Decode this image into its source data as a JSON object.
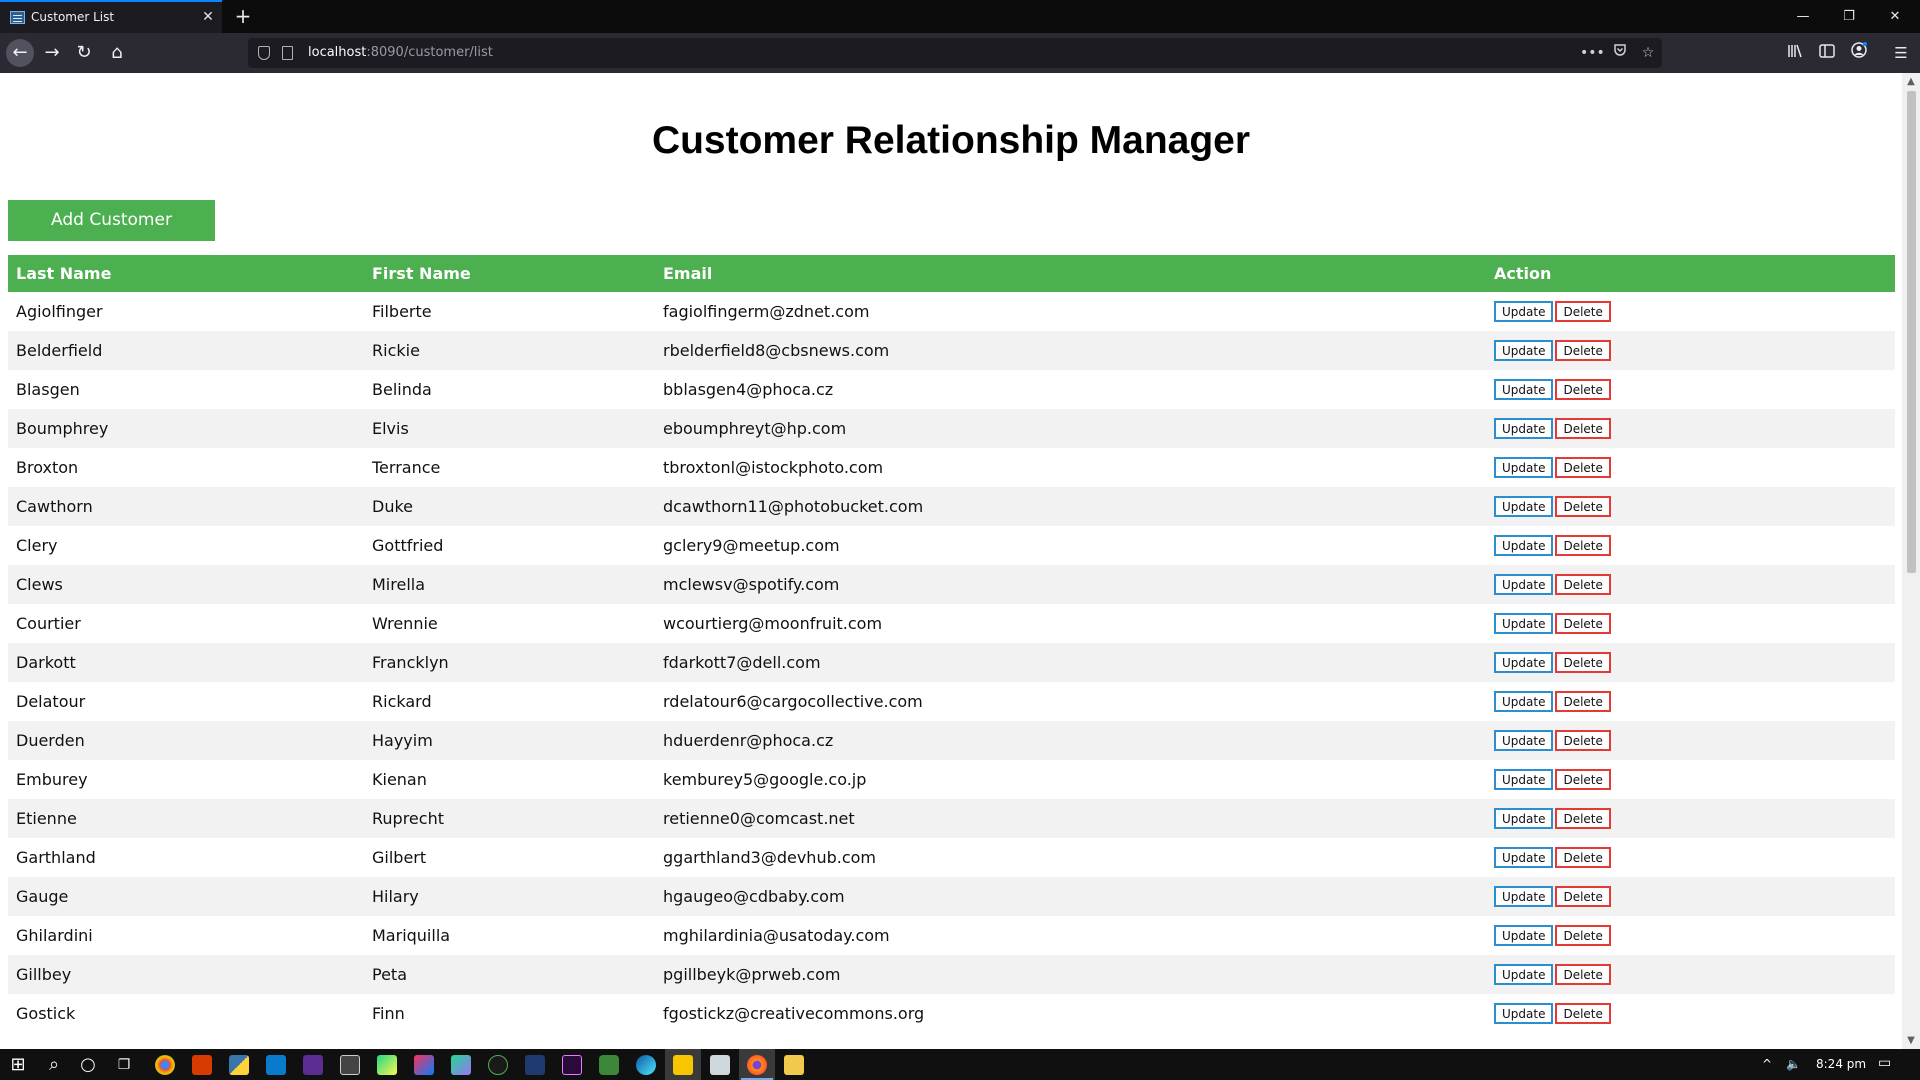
{
  "browser": {
    "tab_title": "Customer List",
    "tab_close": "✕",
    "new_tab": "+",
    "win_minimize": "—",
    "win_restore": "❐",
    "win_close": "✕",
    "url_host": "localhost",
    "url_path": ":8090/customer/list",
    "more": "•••",
    "back": "←",
    "forward": "→",
    "reload": "↻",
    "home": "⌂"
  },
  "page": {
    "title": "Customer Relationship Manager",
    "add_button": "Add Customer"
  },
  "table": {
    "headers": {
      "last_name": "Last Name",
      "first_name": "First Name",
      "email": "Email",
      "action": "Action"
    },
    "update_label": "Update",
    "delete_label": "Delete",
    "rows": [
      {
        "last": "Agiolfinger",
        "first": "Filberte",
        "email": "fagiolfingerm@zdnet.com"
      },
      {
        "last": "Belderfield",
        "first": "Rickie",
        "email": "rbelderfield8@cbsnews.com"
      },
      {
        "last": "Blasgen",
        "first": "Belinda",
        "email": "bblasgen4@phoca.cz"
      },
      {
        "last": "Boumphrey",
        "first": "Elvis",
        "email": "eboumphreyt@hp.com"
      },
      {
        "last": "Broxton",
        "first": "Terrance",
        "email": "tbroxtonl@istockphoto.com"
      },
      {
        "last": "Cawthorn",
        "first": "Duke",
        "email": "dcawthorn11@photobucket.com"
      },
      {
        "last": "Clery",
        "first": "Gottfried",
        "email": "gclery9@meetup.com"
      },
      {
        "last": "Clews",
        "first": "Mirella",
        "email": "mclewsv@spotify.com"
      },
      {
        "last": "Courtier",
        "first": "Wrennie",
        "email": "wcourtierg@moonfruit.com"
      },
      {
        "last": "Darkott",
        "first": "Francklyn",
        "email": "fdarkott7@dell.com"
      },
      {
        "last": "Delatour",
        "first": "Rickard",
        "email": "rdelatour6@cargocollective.com"
      },
      {
        "last": "Duerden",
        "first": "Hayyim",
        "email": "hduerdenr@phoca.cz"
      },
      {
        "last": "Emburey",
        "first": "Kienan",
        "email": "kemburey5@google.co.jp"
      },
      {
        "last": "Etienne",
        "first": "Ruprecht",
        "email": "retienne0@comcast.net"
      },
      {
        "last": "Garthland",
        "first": "Gilbert",
        "email": "ggarthland3@devhub.com"
      },
      {
        "last": "Gauge",
        "first": "Hilary",
        "email": "hgaugeo@cdbaby.com"
      },
      {
        "last": "Ghilardini",
        "first": "Mariquilla",
        "email": "mghilardinia@usatoday.com"
      },
      {
        "last": "Gillbey",
        "first": "Peta",
        "email": "pgillbeyk@prweb.com"
      },
      {
        "last": "Gostick",
        "first": "Finn",
        "email": "fgostickz@creativecommons.org"
      }
    ]
  },
  "taskbar": {
    "time": "8:24 pm",
    "start": "⊞",
    "search": "⌕",
    "cortana": "○",
    "taskview": "❐",
    "tray_chevron": "^",
    "volume": "🔈",
    "notifications": "▭"
  },
  "colors": {
    "accent_green": "#4caf50",
    "update_border": "#2b8ed0",
    "delete_border": "#e53935"
  }
}
